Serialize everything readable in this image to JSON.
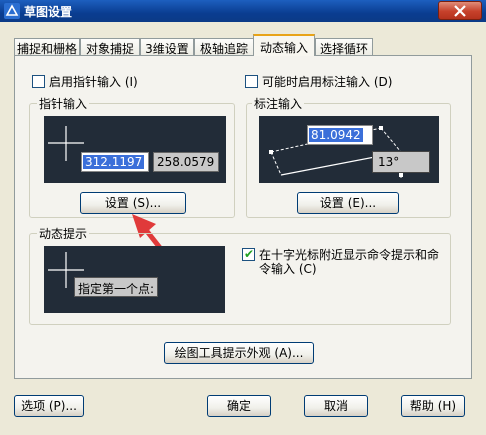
{
  "window": {
    "title": "草图设置"
  },
  "tabs": [
    {
      "label": "捕捉和栅格"
    },
    {
      "label": "对象捕捉"
    },
    {
      "label": "3维设置"
    },
    {
      "label": "极轴追踪"
    },
    {
      "label": "动态输入",
      "active": true
    },
    {
      "label": "选择循环"
    }
  ],
  "pointer_input": {
    "enable_label": "启用指针输入 (I)",
    "enabled": false,
    "group_label": "指针输入",
    "coord_x": "312.1197",
    "coord_y": "258.0579",
    "settings_button": "设置 (S)..."
  },
  "dimension_input": {
    "enable_label": "可能时启用标注输入 (D)",
    "enabled": false,
    "group_label": "标注输入",
    "length_value": "81.0942",
    "angle_value": "13°",
    "settings_button": "设置 (E)..."
  },
  "dynamic_prompts": {
    "group_label": "动态提示",
    "prompt_text": "指定第一个点:",
    "show_prompts_label_line1": "在十字光标附近显示命令提示和命",
    "show_prompts_label_line2": "令输入 (C)",
    "show_prompts_checked": true
  },
  "drafting_tooltip_button": "绘图工具提示外观 (A)...",
  "footer": {
    "options_button": "选项 (P)...",
    "ok_button": "确定",
    "cancel_button": "取消",
    "help_button": "帮助 (H)"
  },
  "colors": {
    "preview_bg": "#222c38",
    "highlight": "#3b6fd9",
    "arrow": "#e03a3a",
    "titlebar": "#0a3d91"
  }
}
